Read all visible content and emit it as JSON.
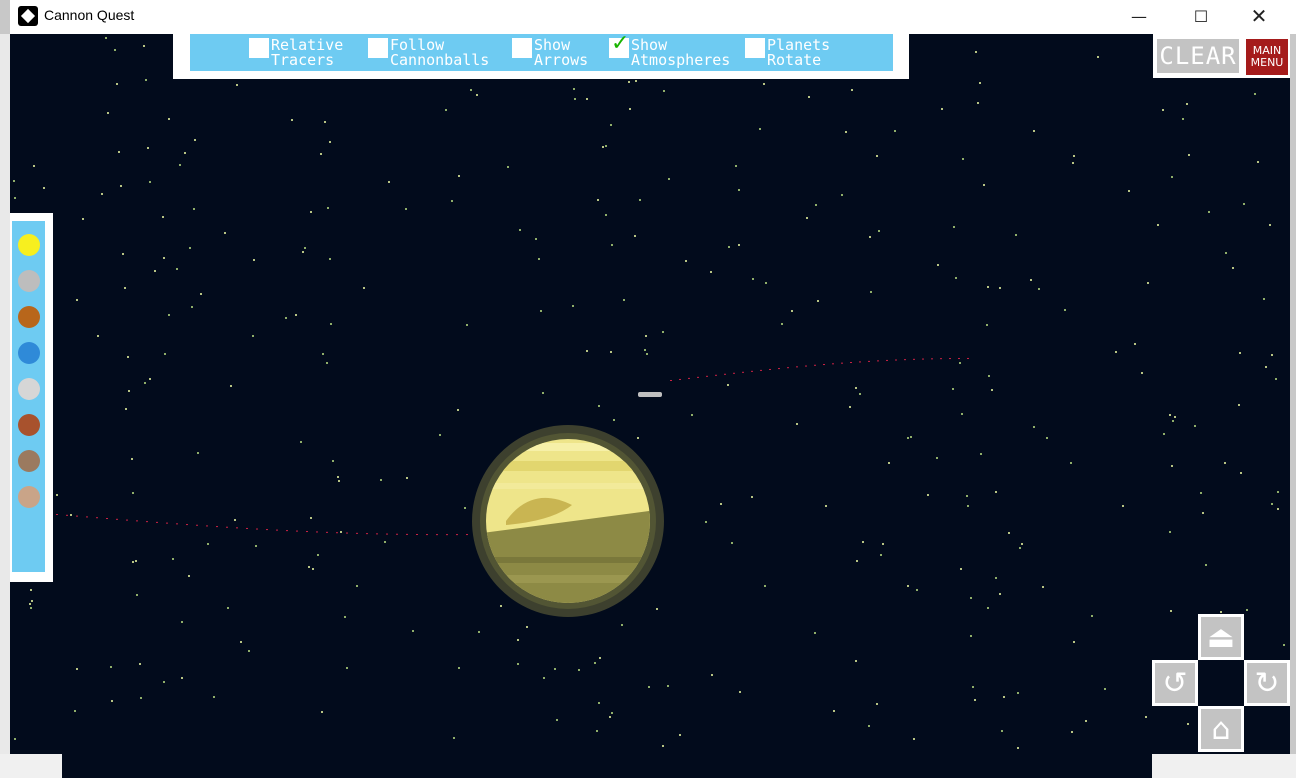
{
  "window": {
    "title": "Cannon Quest",
    "minimize": "—",
    "maximize": "☐",
    "close": "✕"
  },
  "options": [
    {
      "line1": "Relative",
      "line2": "Tracers",
      "checked": false
    },
    {
      "line1": "Follow",
      "line2": "Cannonballs",
      "checked": false
    },
    {
      "line1": "Show",
      "line2": "Arrows",
      "checked": false
    },
    {
      "line1": "Show",
      "line2": "Atmospheres",
      "checked": true
    },
    {
      "line1": "Planets",
      "line2": "Rotate",
      "checked": false
    }
  ],
  "check_glyph": "✓",
  "buttons": {
    "clear": "CLEAR",
    "main_menu_line1": "MAIN",
    "main_menu_line2": "MENU"
  },
  "palette": [
    {
      "name": "sun",
      "color": "#f7ef1f"
    },
    {
      "name": "moon-gray",
      "color": "#bdbdbd"
    },
    {
      "name": "mars",
      "color": "#b8661b"
    },
    {
      "name": "earth",
      "color": "#2f8ad8"
    },
    {
      "name": "moon-white",
      "color": "#d6d6d6"
    },
    {
      "name": "jupiter",
      "color": "#a8522d"
    },
    {
      "name": "asteroid",
      "color": "#9b7a5f"
    },
    {
      "name": "comet",
      "color": "#c9a488"
    }
  ],
  "controls": {
    "up": "⏏",
    "rotate_left": "↺",
    "rotate_right": "↻",
    "home": "⌂"
  },
  "colors": {
    "space": "#020b1c",
    "panel": "#6ecbf2",
    "planet": "#e5de7a",
    "trajectory": "#cc2244"
  }
}
